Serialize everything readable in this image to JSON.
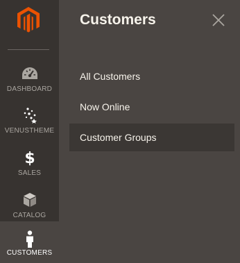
{
  "sidebar": {
    "logo": "magento-logo",
    "items": [
      {
        "label": "DASHBOARD",
        "icon": "speedometer-icon"
      },
      {
        "label": "VENUSTHEME",
        "icon": "sparkle-icon"
      },
      {
        "label": "SALES",
        "icon": "dollar-icon"
      },
      {
        "label": "CATALOG",
        "icon": "box-icon"
      },
      {
        "label": "CUSTOMERS",
        "icon": "person-icon",
        "active": true
      }
    ]
  },
  "panel": {
    "title": "Customers",
    "close_icon": "close-icon",
    "items": [
      {
        "label": "All Customers"
      },
      {
        "label": "Now Online"
      },
      {
        "label": "Customer Groups",
        "highlighted": true
      }
    ]
  },
  "colors": {
    "sidebar_bg": "#373330",
    "panel_bg": "#4a4542",
    "highlight_bg": "#3b3734",
    "logo_orange": "#eb5202",
    "text_light": "#f7f3eb",
    "text_muted": "#aaa6a0"
  }
}
